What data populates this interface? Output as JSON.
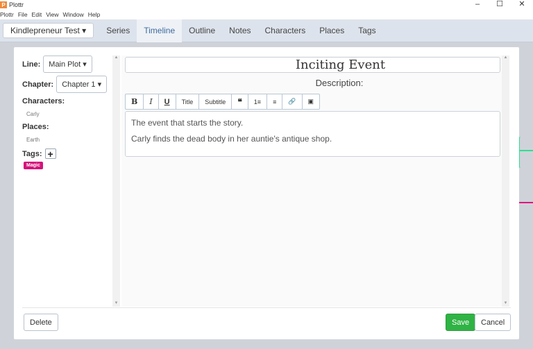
{
  "window": {
    "title": "Plottr",
    "menu": [
      "Plottr",
      "File",
      "Edit",
      "View",
      "Window",
      "Help"
    ]
  },
  "nav": {
    "project": "Kindlepreneur Test",
    "tabs": [
      "Series",
      "Timeline",
      "Outline",
      "Notes",
      "Characters",
      "Places",
      "Tags"
    ],
    "active": "Timeline"
  },
  "modal": {
    "line_label": "Line:",
    "line_value": "Main Plot",
    "chapter_label": "Chapter:",
    "chapter_value": "Chapter 1",
    "characters_label": "Characters:",
    "characters": [
      "Carly"
    ],
    "places_label": "Places:",
    "places": [
      "Earth"
    ],
    "tags_label": "Tags:",
    "tags": [
      {
        "name": "Magic",
        "color": "#d4147a"
      }
    ],
    "title": "Inciting Event",
    "description_label": "Description:",
    "toolbar": [
      "B",
      "I",
      "U",
      "Title",
      "Subtitle",
      "❝",
      "1≡",
      "≡",
      "🔗",
      "▣"
    ],
    "description": [
      "The event that starts the story.",
      "Carly finds the dead body in her auntie's antique shop."
    ],
    "delete_label": "Delete",
    "save_label": "Save",
    "cancel_label": "Cancel"
  }
}
